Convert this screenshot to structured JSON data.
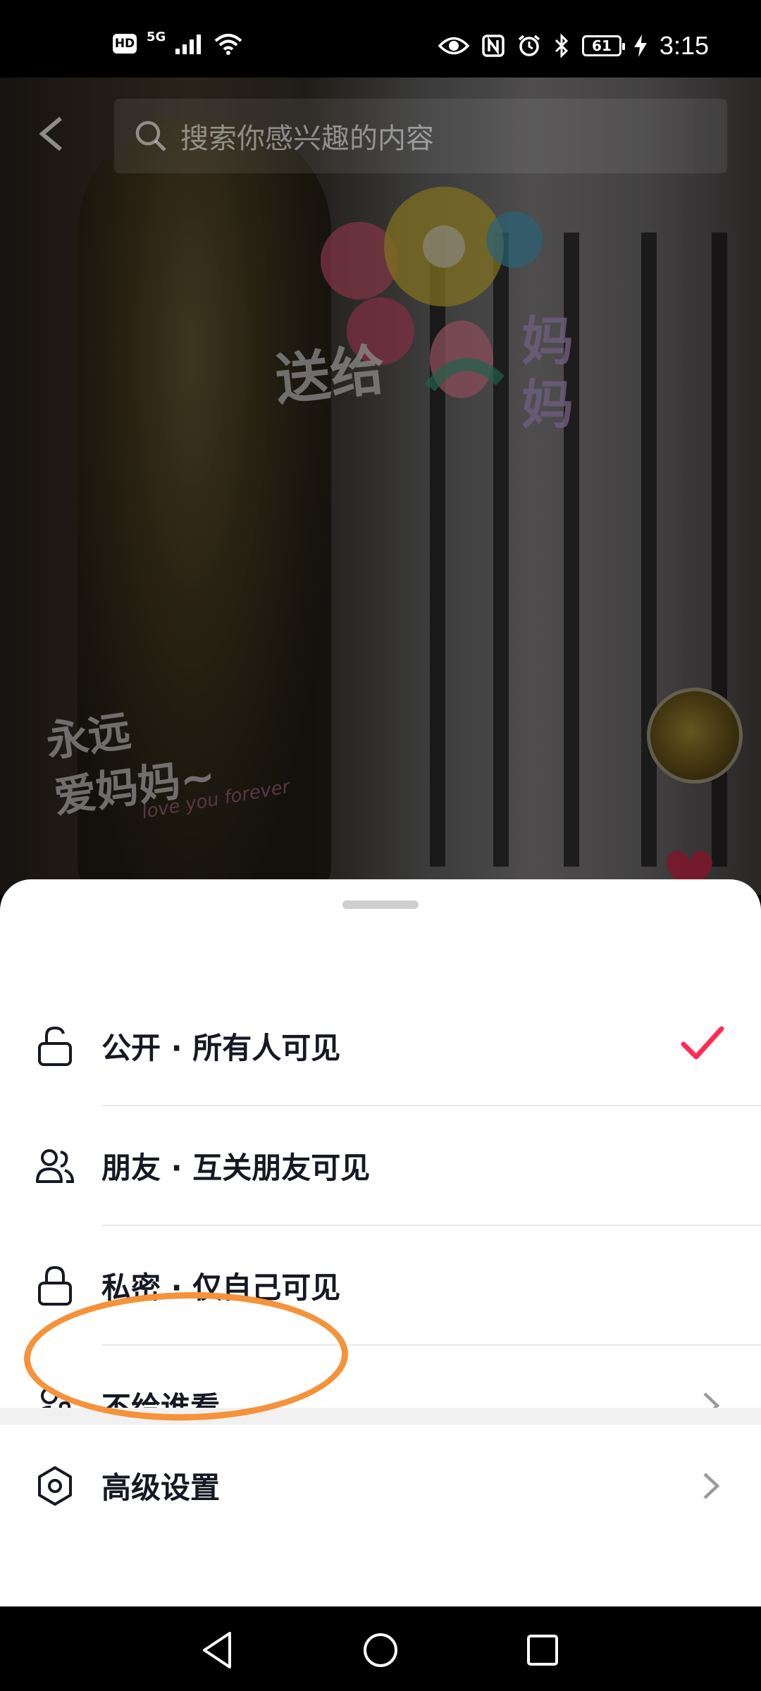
{
  "status_bar": {
    "hd_label": "HD",
    "network_label": "5G",
    "battery_level": "61",
    "time": "3:15"
  },
  "video": {
    "search_placeholder": "搜索你感兴趣的内容",
    "sticker_line_a": "送给",
    "sticker_line_b": "妈妈",
    "sticker_forever": "永远\n爱妈妈~",
    "sticker_forever_sub": "love you forever"
  },
  "visibility_sheet": {
    "options": [
      {
        "label": "公开 · 所有人可见",
        "icon": "unlocked-padlock-icon",
        "selected": true
      },
      {
        "label": "朋友 · 互关朋友可见",
        "icon": "friends-icon",
        "selected": false
      },
      {
        "label": "私密 · 仅自己可见",
        "icon": "padlock-icon",
        "selected": false
      },
      {
        "label": "不给谁看",
        "icon": "user-lock-icon",
        "has_chevron": true
      }
    ],
    "advanced": {
      "label": "高级设置",
      "icon": "hexagon-settings-icon",
      "has_chevron": true
    }
  },
  "colors": {
    "accent": "#fe2c55",
    "annotation": "#f5923a",
    "text": "#161823"
  },
  "nav_bar": {
    "buttons": [
      "back-triangle-icon",
      "home-circle-icon",
      "recents-square-icon"
    ]
  }
}
